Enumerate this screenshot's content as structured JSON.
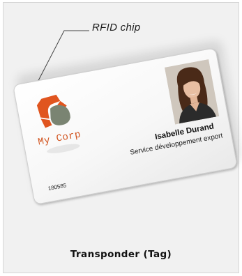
{
  "callout": {
    "label": "RFID chip"
  },
  "card": {
    "logo": {
      "icon": "my-corp-logo-icon",
      "text": "My Corp",
      "colors": {
        "primary": "#e0551f",
        "secondary": "#7a8472",
        "text": "#d2541f"
      }
    },
    "holder_name": "Isabelle Durand",
    "department": "Service développement export",
    "card_number": "180585",
    "photo": {
      "icon": "id-photo-icon"
    }
  },
  "caption": "Transponder (Tag)"
}
